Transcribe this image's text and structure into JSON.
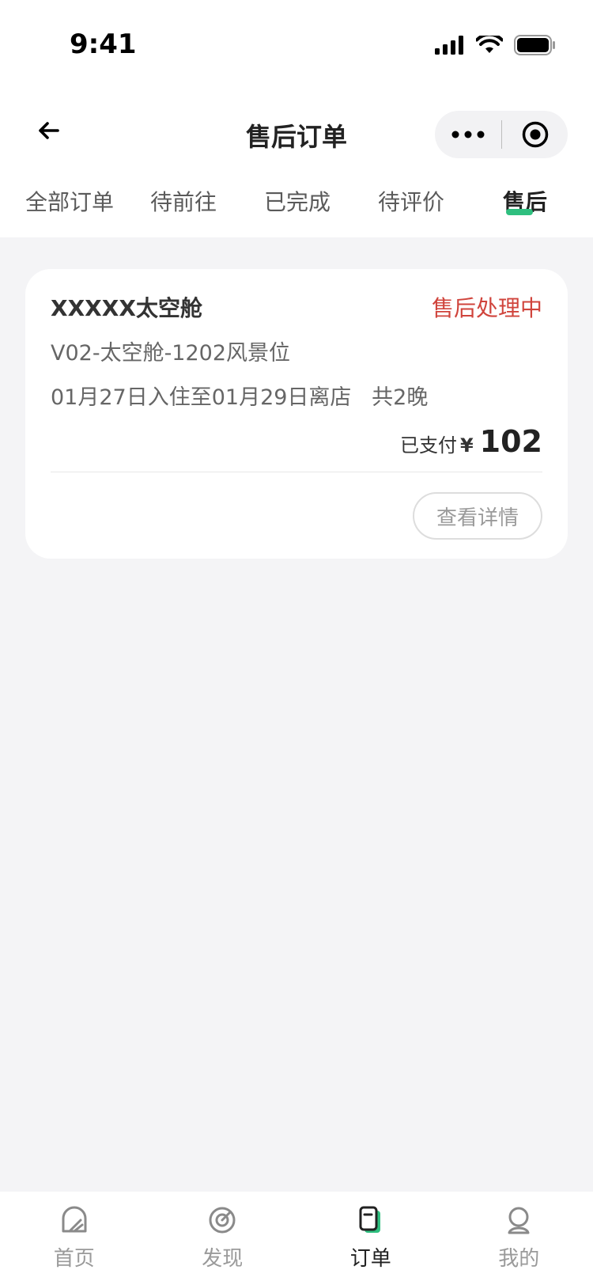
{
  "status_bar": {
    "time": "9:41"
  },
  "nav": {
    "title": "售后订单"
  },
  "tabs": [
    {
      "label": "全部订单"
    },
    {
      "label": "待前往"
    },
    {
      "label": "已完成"
    },
    {
      "label": "待评价"
    },
    {
      "label": "售后"
    }
  ],
  "active_tab": 4,
  "colors": {
    "accent": "#2fbf7f",
    "status_red": "#d0443c",
    "background": "#f4f4f6"
  },
  "order": {
    "name": "XXXXX太空舱",
    "status": "售后处理中",
    "room": "V02-太空舱-1202风景位",
    "dates": "01月27日入住至01月29日离店   共2晚",
    "paid_label": "已支付",
    "currency": "¥",
    "amount": "102",
    "detail_button": "查看详情"
  },
  "tabbar": [
    {
      "label": "首页",
      "icon": "home-icon"
    },
    {
      "label": "发现",
      "icon": "discover-icon"
    },
    {
      "label": "订单",
      "icon": "order-icon"
    },
    {
      "label": "我的",
      "icon": "profile-icon"
    }
  ],
  "tabbar_active": 2
}
